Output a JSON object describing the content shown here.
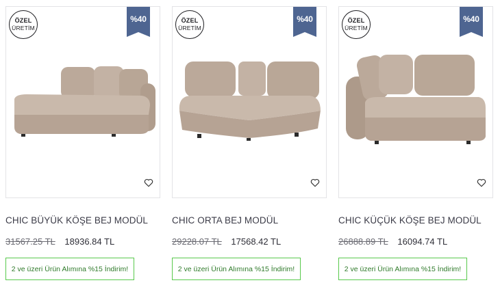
{
  "products": [
    {
      "badge_top": "ÖZEL",
      "badge_bottom": "ÜRETİM",
      "discount": "%40",
      "name": "CHIC BÜYÜK KÖŞE BEJ MODÜL",
      "old_price": "31567.25 TL",
      "new_price": "18936.84 TL",
      "promo": "2 ve üzeri Ürün Alımına %15 İndirim!"
    },
    {
      "badge_top": "ÖZEL",
      "badge_bottom": "ÜRETİM",
      "discount": "%40",
      "name": "CHIC ORTA BEJ MODÜL",
      "old_price": "29228.07 TL",
      "new_price": "17568.42 TL",
      "promo": "2 ve üzeri Ürün Alımına %15 İndirim!"
    },
    {
      "badge_top": "ÖZEL",
      "badge_bottom": "ÜRETİM",
      "discount": "%40",
      "name": "CHIC KÜÇÜK KÖŞE BEJ MODÜL",
      "old_price": "26888.89 TL",
      "new_price": "16094.74 TL",
      "promo": "2 ve üzeri Ürün Alımına %15 İndirim!"
    }
  ],
  "icons": {
    "favorite": "heart-outline-icon"
  },
  "colors": {
    "discount_badge": "#4e6591",
    "promo_border": "#57c94b",
    "sofa_fabric": "#c2b1a3"
  }
}
